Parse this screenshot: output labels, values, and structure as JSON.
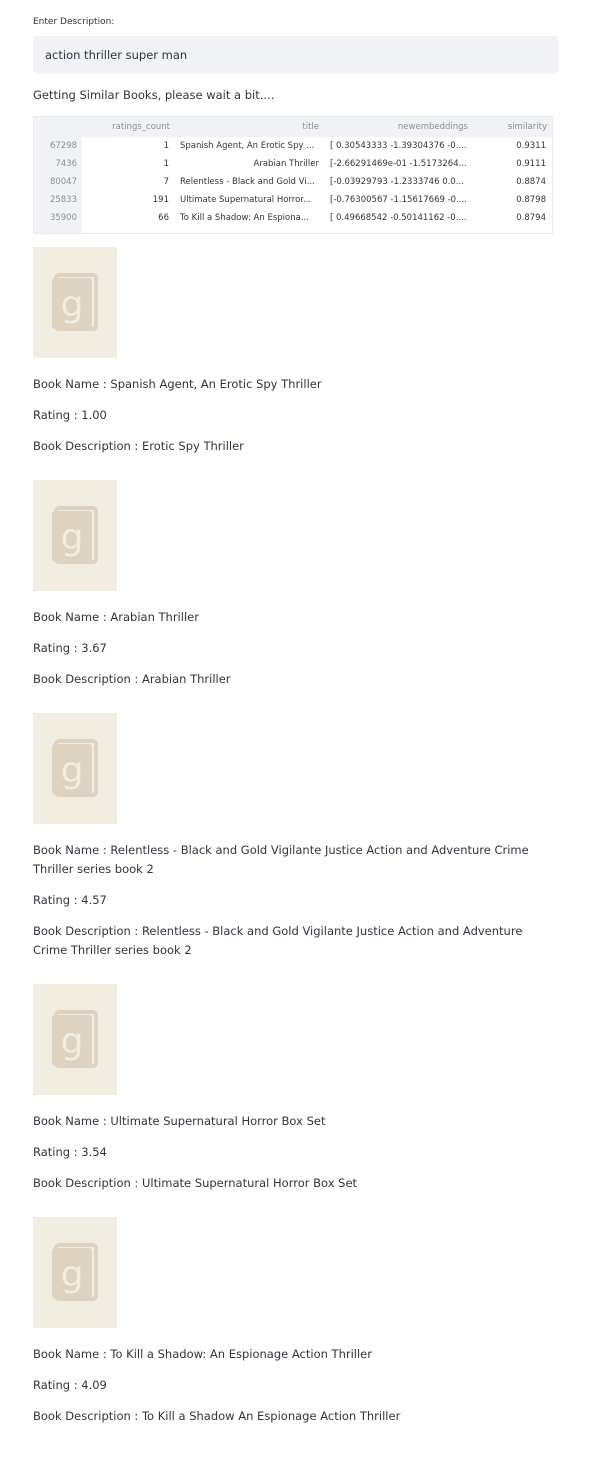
{
  "input": {
    "label": "Enter Description:",
    "value": "action thriller super man"
  },
  "status_text": "Getting Similar Books, please wait a bit....",
  "table": {
    "columns": [
      "",
      "ratings_count",
      "title",
      "newembeddings",
      "similarity"
    ],
    "rows": [
      {
        "index": "67298",
        "ratings_count": "1",
        "title": "Spanish Agent, An Erotic Spy ...",
        "newembeddings": "[ 0.30543333 -1.39304376 -0....",
        "similarity": "0.9311"
      },
      {
        "index": "7436",
        "ratings_count": "1",
        "title": "Arabian Thriller",
        "newembeddings": "[-2.66291469e-01 -1.5173264...",
        "similarity": "0.9111"
      },
      {
        "index": "80047",
        "ratings_count": "7",
        "title": "Relentless - Black and Gold Vi...",
        "newembeddings": "[-0.03929793 -1.2333746 0.0...",
        "similarity": "0.8874"
      },
      {
        "index": "25833",
        "ratings_count": "191",
        "title": "Ultimate Supernatural Horror...",
        "newembeddings": "[-0.76300567 -1.15617669 -0....",
        "similarity": "0.8798"
      },
      {
        "index": "35900",
        "ratings_count": "66",
        "title": "To Kill a Shadow: An Espiona...",
        "newembeddings": "[ 0.49668542 -0.50141162 -0....",
        "similarity": "0.8794"
      }
    ]
  },
  "books": [
    {
      "cover_icon": "goodreads-placeholder-icon",
      "name": "Book Name : Spanish Agent, An Erotic Spy Thriller",
      "rating": "Rating : 1.00",
      "description": "Book Description : Erotic Spy Thriller"
    },
    {
      "cover_icon": "goodreads-placeholder-icon",
      "name": "Book Name : Arabian Thriller",
      "rating": "Rating : 3.67",
      "description": "Book Description : Arabian Thriller"
    },
    {
      "cover_icon": "goodreads-placeholder-icon",
      "name": "Book Name : Relentless - Black and Gold Vigilante Justice Action and Adventure Crime Thriller series book 2",
      "rating": "Rating : 4.57",
      "description": "Book Description : Relentless - Black and Gold Vigilante Justice Action and Adventure Crime Thriller series book 2"
    },
    {
      "cover_icon": "goodreads-placeholder-icon",
      "name": "Book Name : Ultimate Supernatural Horror Box Set",
      "rating": "Rating : 3.54",
      "description": "Book Description : Ultimate Supernatural Horror Box Set"
    },
    {
      "cover_icon": "goodreads-placeholder-icon",
      "name": "Book Name : To Kill a Shadow: An Espionage Action Thriller",
      "rating": "Rating : 4.09",
      "description": "Book Description : To Kill a Shadow An Espionage Action Thriller"
    }
  ],
  "colors": {
    "input_bg": "#f0f2f6",
    "text": "#31333f",
    "cover_bg": "#f1ede1",
    "cover_icon": "#ddd3c0"
  }
}
